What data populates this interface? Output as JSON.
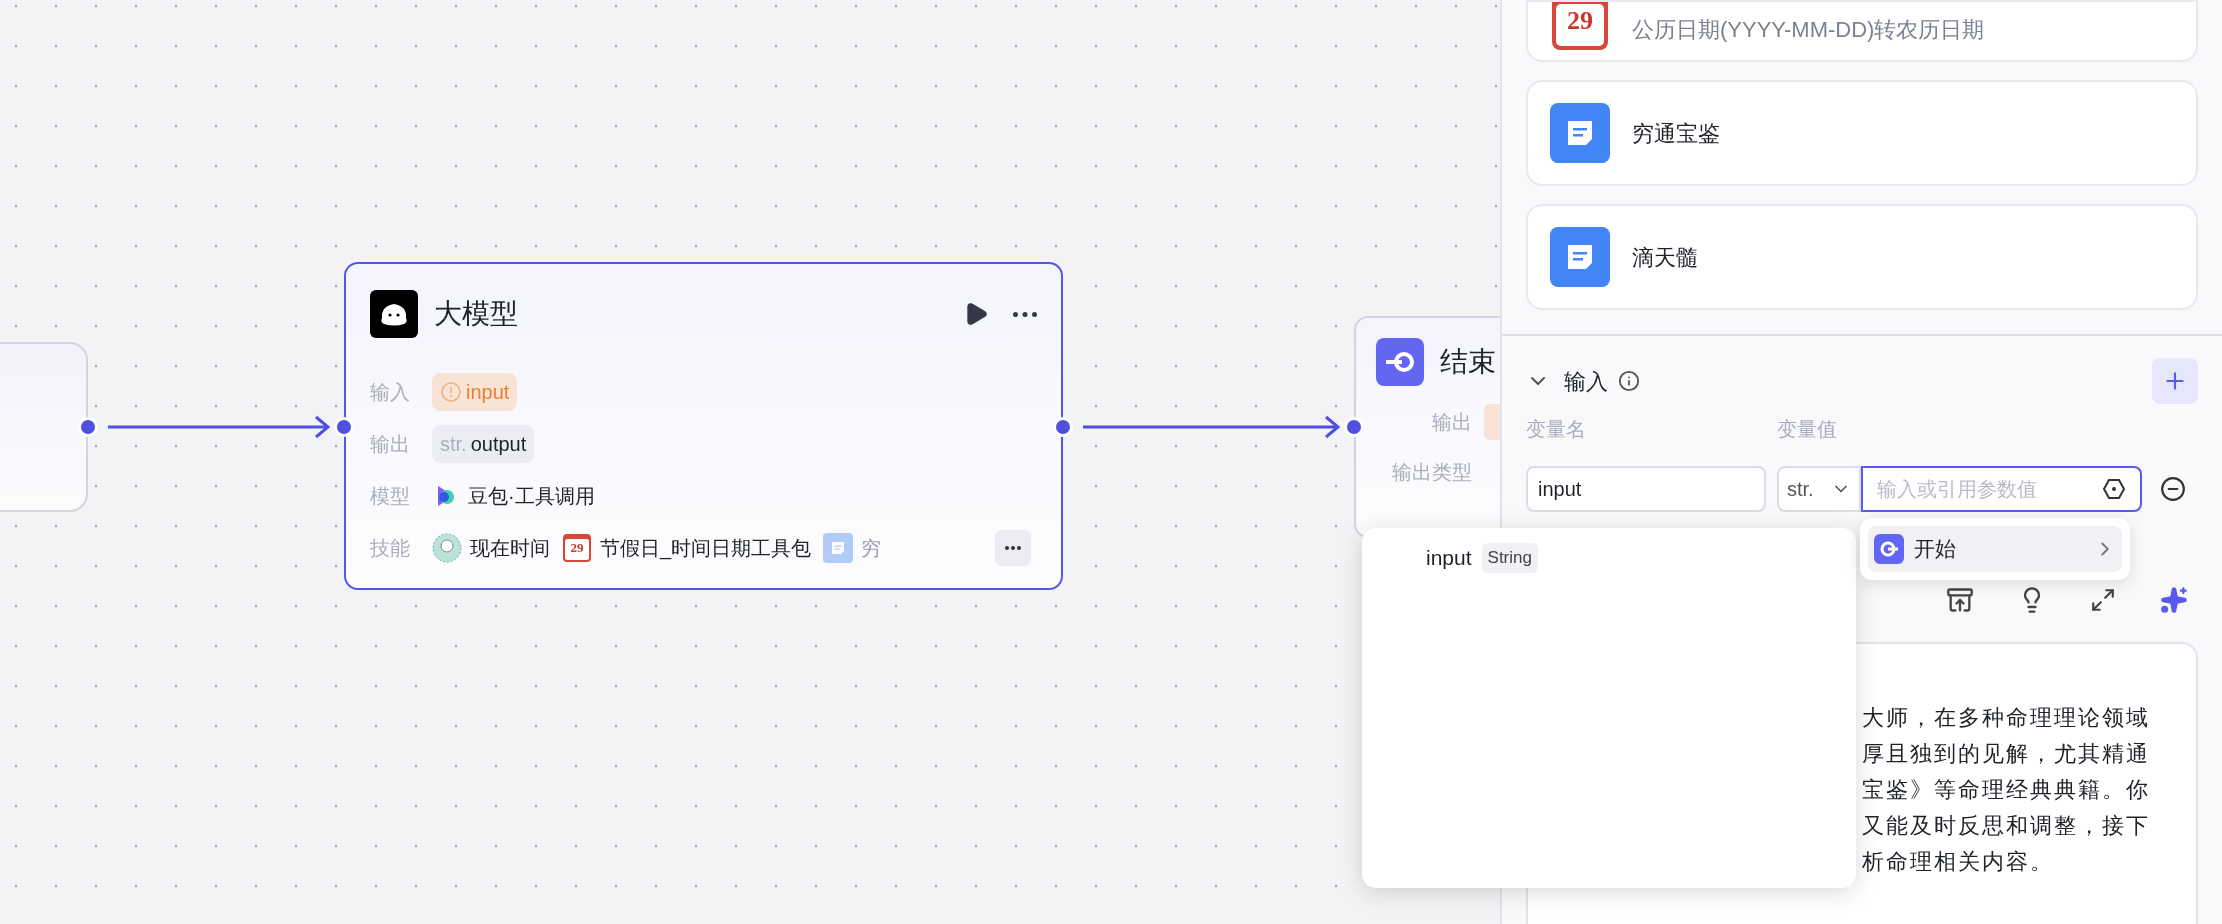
{
  "source_node": {
    "kind": "partial"
  },
  "llm_node": {
    "title": "大模型",
    "rows": [
      {
        "kind": "input",
        "label": "输入",
        "value": "input",
        "warning": true
      },
      {
        "kind": "output",
        "label": "输出",
        "type": "str.",
        "value": "output"
      },
      {
        "kind": "model",
        "label": "模型",
        "value": "豆包·工具调用"
      },
      {
        "kind": "skills",
        "label": "技能",
        "items": [
          {
            "kind": "avatar",
            "name": "现在时间",
            "faded": false
          },
          {
            "kind": "calendar",
            "day": "29",
            "name": "节假日_时间日期工具包",
            "faded": false
          },
          {
            "kind": "doc",
            "name": "穷",
            "faded": true
          }
        ]
      }
    ]
  },
  "end_node": {
    "title": "结束",
    "rows": [
      {
        "label": "输出",
        "kind": "chip"
      },
      {
        "label": "输出类型",
        "kind": "plain"
      }
    ]
  },
  "panel": {
    "cards": [
      {
        "kind": "calendar",
        "day": "29",
        "text": "公历日期(YYYY-MM-DD)转农历日期"
      },
      {
        "kind": "doc",
        "text": "穷通宝鉴"
      },
      {
        "kind": "doc",
        "text": "滴天髓"
      }
    ],
    "input_section": {
      "title": "输入",
      "expanded": true,
      "columns": [
        "变量名",
        "变量值"
      ],
      "variables": [
        {
          "name": "input",
          "type": "str.",
          "placeholder": "输入或引用参数值",
          "focused": true
        }
      ]
    },
    "prompt_lines": [
      "大师，在多种命理理论领域",
      "厚且独到的见解，尤其精通",
      "宝鉴》等命理经典典籍。你",
      "又能及时反思和调整，接下",
      "析命理相关内容。"
    ]
  },
  "reference_menu": {
    "items": [
      {
        "label": "开始",
        "selected": true
      }
    ]
  },
  "variable_list": {
    "items": [
      {
        "name": "input",
        "type": "String"
      }
    ]
  }
}
